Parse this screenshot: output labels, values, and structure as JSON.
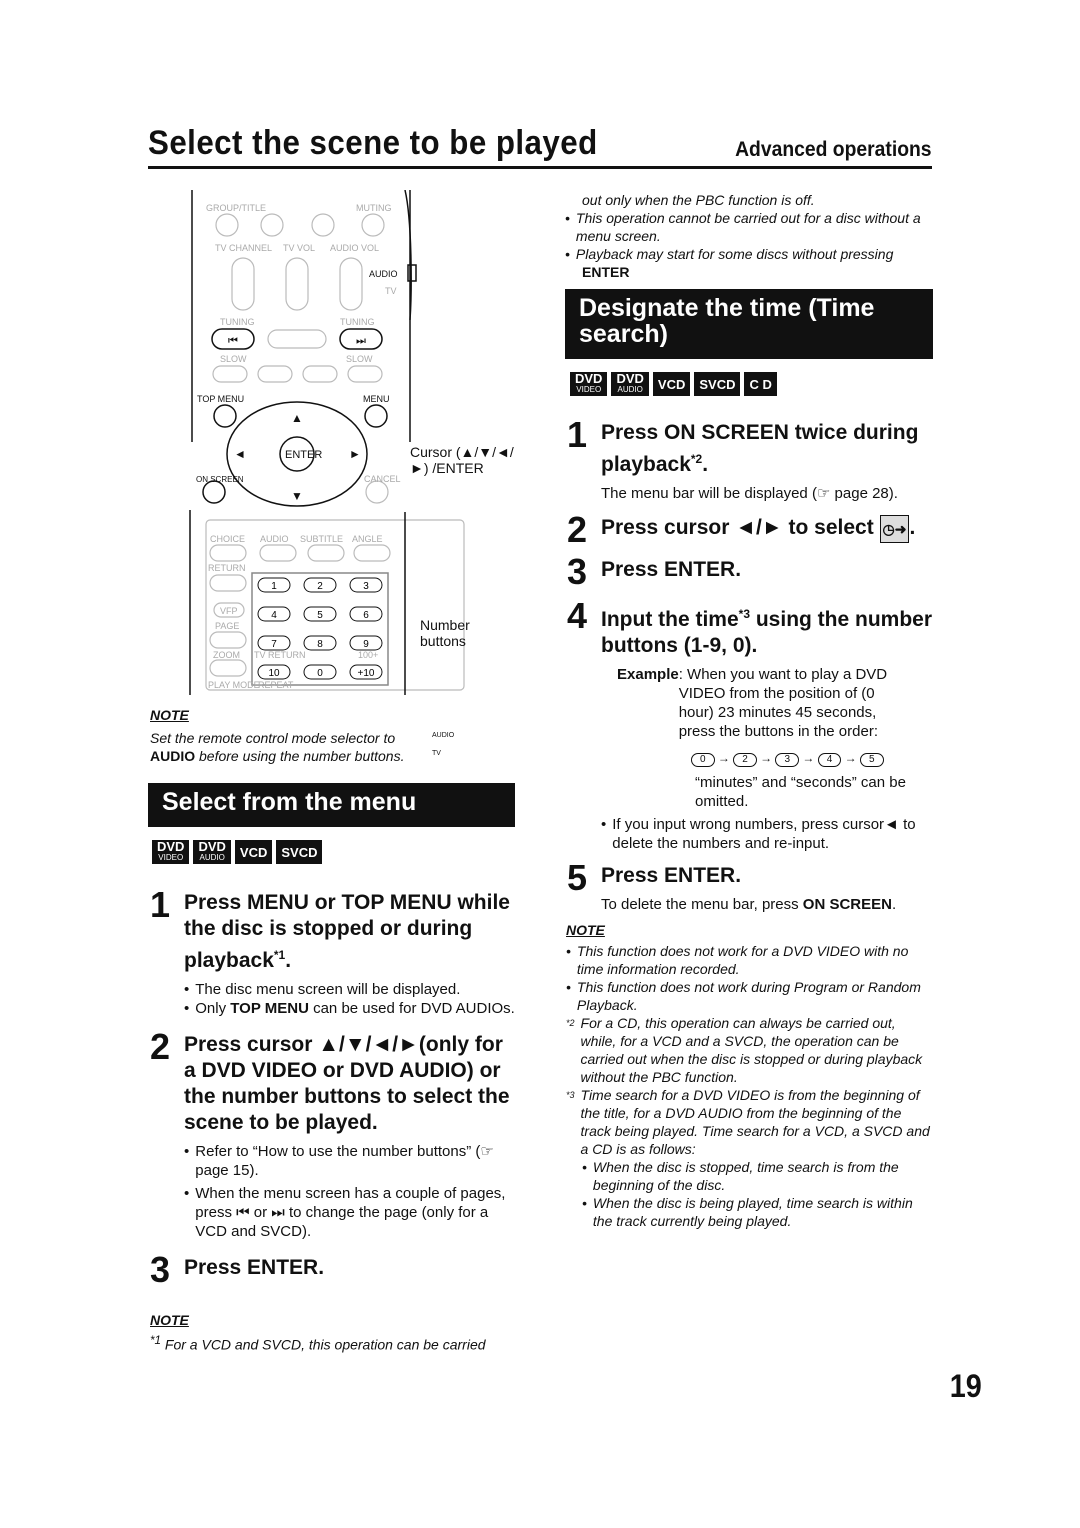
{
  "header": {
    "title": "Select the scene to be played",
    "section": "Advanced operations"
  },
  "remote": {
    "labels": [
      "GROUP/TITLE",
      "MUTING",
      "TV CHANNEL",
      "TV VOL",
      "AUDIO VOL",
      "AUDIO",
      "TV",
      "TUNING",
      "TUNING",
      "SLOW",
      "SLOW",
      "TOP MENU",
      "MENU",
      "ENTER",
      "ON SCREEN",
      "CANCEL",
      "CHOICE",
      "AUDIO",
      "SUBTITLE",
      "ANGLE",
      "RETURN",
      "VFP",
      "PAGE",
      "ZOOM",
      "TV RETURN",
      "100+",
      "PLAY MODE",
      "REPEAT"
    ],
    "number_keys": [
      "1",
      "2",
      "3",
      "4",
      "5",
      "6",
      "7",
      "8",
      "9",
      "10",
      "0",
      "+10"
    ],
    "callout_cursor": "Cursor (▲/▼/◄/►) /ENTER",
    "callout_numbers": "Number buttons"
  },
  "left": {
    "note1": {
      "heading": "NOTE",
      "text_pre": "Set the remote control mode selector to ",
      "bold": "AUDIO",
      "text_post": " before using the number buttons.",
      "switch_audio": "AUDIO",
      "switch_tv": "TV"
    },
    "band": "Select from the menu",
    "badges": [
      {
        "top": "DVD",
        "sub": "VIDEO"
      },
      {
        "top": "DVD",
        "sub": "AUDIO"
      },
      {
        "top": "VCD",
        "sub": ""
      },
      {
        "top": "SVCD",
        "sub": ""
      }
    ],
    "step1": {
      "num": "1",
      "text": "Press MENU or TOP MENU while the disc is stopped or during playback",
      "sup": "*1",
      "end": ".",
      "bullets": [
        "The disc menu screen will be displayed."
      ],
      "b2_pre": "Only ",
      "b2_bold": "TOP MENU",
      "b2_post": " can be used for DVD AUDIOs."
    },
    "step2": {
      "num": "2",
      "text": "Press cursor ▲/▼/◄/►(only for a DVD VIDEO or DVD AUDIO) or the number buttons to select the scene to be played.",
      "bullets": [
        "Refer to “How to use the number buttons” (☞ page 15).",
        "When the menu screen has a couple of pages, press ⏮ or ⏭ to change the page (only for a VCD and SVCD)."
      ]
    },
    "step3": {
      "num": "3",
      "text": "Press ENTER."
    },
    "note2": {
      "heading": "NOTE",
      "sup": "*1",
      "text": "For a VCD and SVCD, this operation can be carried"
    }
  },
  "right": {
    "top_text": "out only when the PBC function is off.",
    "top_bullets": [
      "This operation cannot be carried out for a disc without a menu screen.",
      "Playback may start for some discs without pressing"
    ],
    "top_bold": "ENTER",
    "band": "Designate the time (Time search)",
    "badges": [
      {
        "top": "DVD",
        "sub": "VIDEO"
      },
      {
        "top": "DVD",
        "sub": "AUDIO"
      },
      {
        "top": "VCD",
        "sub": ""
      },
      {
        "top": "SVCD",
        "sub": ""
      },
      {
        "top": "C D",
        "sub": ""
      }
    ],
    "step1": {
      "num": "1",
      "text": "Press ON SCREEN twice during playback",
      "sup": "*2",
      "end": ".",
      "desc": "The menu bar will be displayed (☞ page 28)."
    },
    "step2": {
      "num": "2",
      "text": "Press cursor ◄/► to select",
      "icon": "clock-arrow-icon"
    },
    "step3": {
      "num": "3",
      "text": "Press ENTER."
    },
    "step4": {
      "num": "4",
      "text_a": "Input the time",
      "sup": "*3",
      "text_b": " using the number buttons (1-9, 0).",
      "example_label": "Example",
      "example_text": ": When you want to play a DVD VIDEO from the position of (0 hour) 23 minutes 45 seconds, press the buttons in the order:",
      "sequence": [
        "0",
        "2",
        "3",
        "4",
        "5"
      ],
      "omit": "“minutes” and “seconds” can be omitted.",
      "bullet": "If you input wrong numbers, press cursor◄ to delete the numbers and re-input."
    },
    "step5": {
      "num": "5",
      "text": "Press ENTER.",
      "desc_pre": "To delete the menu bar, press ",
      "desc_bold": "ON SCREEN",
      "desc_post": "."
    },
    "note": {
      "heading": "NOTE",
      "bullets": [
        "This function does not work for a DVD VIDEO with no time information recorded.",
        "This function does not work during Program or Random Playback."
      ],
      "fn2": {
        "mark": "*2",
        "text": "For a CD, this operation can always be carried out, while, for a VCD and a SVCD, the operation can be carried out when the disc is stopped or during playback without the PBC function."
      },
      "fn3": {
        "mark": "*3",
        "text": "Time search for a DVD VIDEO is from the beginning of the title, for a DVD AUDIO from the beginning of the track being played. Time search for a VCD, a SVCD and a CD is as follows:"
      },
      "sub_bullets": [
        "When the disc is stopped, time search is from the beginning of the disc.",
        "When the disc is being played, time search is within the track currently being played."
      ]
    }
  },
  "page_number": "19"
}
